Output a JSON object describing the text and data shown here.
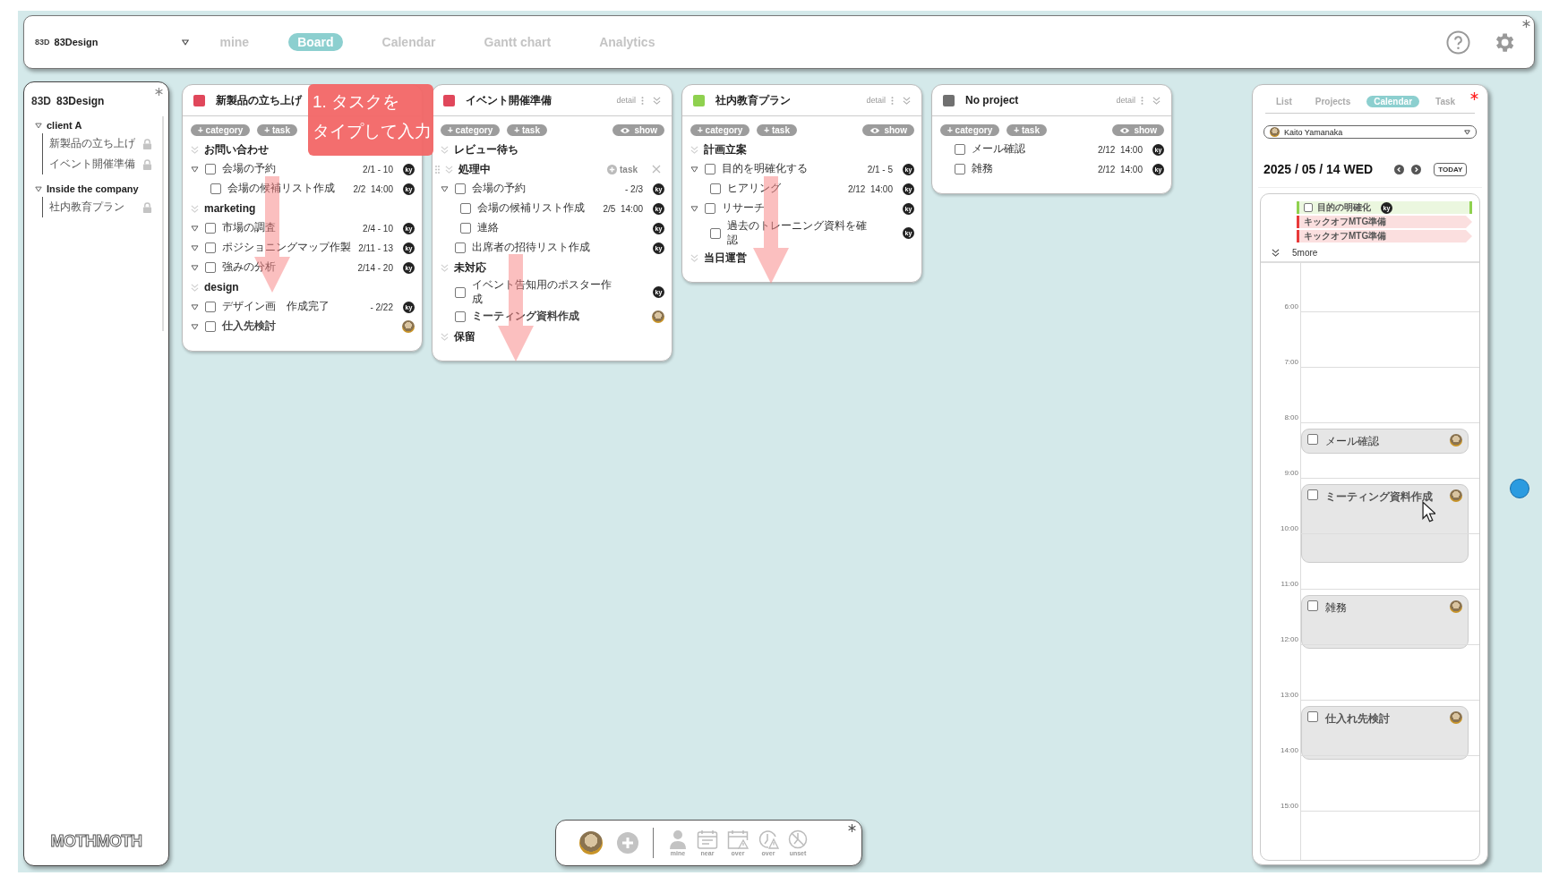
{
  "top_bar": {
    "logo": "83D",
    "workspace": "83Design",
    "tabs": [
      {
        "label": "mine",
        "selected": false
      },
      {
        "label": "Board",
        "selected": true
      },
      {
        "label": "Calendar",
        "selected": false
      },
      {
        "label": "Gantt chart",
        "selected": false
      },
      {
        "label": "Analytics",
        "selected": false
      }
    ]
  },
  "sidebar": {
    "logo": "83D",
    "workspace": "83Design",
    "groups": [
      {
        "name": "client A",
        "expanded": true,
        "projects": [
          {
            "name": "新製品の立ち上げ",
            "locked": true
          },
          {
            "name": "イベント開催準備",
            "locked": true
          }
        ]
      },
      {
        "name": "Inside the company",
        "expanded": true,
        "projects": [
          {
            "name": "社内教育プラン",
            "locked": true
          }
        ]
      }
    ],
    "footer_logo": "MOTHMOTH"
  },
  "board": {
    "columns": [
      {
        "title": "新製品の立ち上げ",
        "color": "#e0475b",
        "chips": [
          "+ category",
          "+ task"
        ],
        "categories": [
          {
            "name": "お問い合わせ",
            "tasks": [
              {
                "name": "会場の予約",
                "date": "2/1 - 10",
                "checked": false,
                "collapsible": true,
                "assignee": {
                  "kind": "initials",
                  "text": "ky"
                },
                "children": [
                  {
                    "name": "会場の候補リスト作成",
                    "date": "2/2  14:00",
                    "checked": false,
                    "assignee": {
                      "kind": "initials",
                      "text": "ky"
                    }
                  }
                ]
              }
            ]
          },
          {
            "name": "marketing",
            "tasks": [
              {
                "name": "市場の調査",
                "date": "2/4 - 10",
                "checked": false,
                "collapsible": true,
                "assignee": {
                  "kind": "initials",
                  "text": "ky"
                }
              },
              {
                "name": "ポジショニングマップ作製",
                "date": "2/11 - 13",
                "checked": false,
                "collapsible": true,
                "assignee": {
                  "kind": "initials",
                  "text": "ky"
                }
              },
              {
                "name": "強みの分析",
                "date": "2/14 - 20",
                "checked": false,
                "collapsible": true,
                "assignee": {
                  "kind": "initials",
                  "text": "ky"
                }
              }
            ]
          },
          {
            "name": "design",
            "tasks": [
              {
                "name": "デザイン画　作成完了",
                "date": "- 2/22",
                "checked": false,
                "collapsible": true,
                "assignee": {
                  "kind": "initials",
                  "text": "ky"
                }
              },
              {
                "name": "仕入先検討",
                "checked": false,
                "collapsible": true,
                "emphasis": true,
                "assignee": {
                  "kind": "photo"
                }
              }
            ]
          }
        ]
      },
      {
        "title": "イベント開催準備",
        "color": "#e0475b",
        "detail": "detail",
        "chips": [
          "+ category",
          "+ task"
        ],
        "show": "show",
        "categories": [
          {
            "name": "レビュー待ち"
          },
          {
            "name": "処理中",
            "draggable": true,
            "add_task": "task",
            "tasks": [
              {
                "name": "会場の予約",
                "date": "- 2/3",
                "checked": false,
                "collapsible": true,
                "assignee": {
                  "kind": "initials",
                  "text": "ky"
                },
                "children": [
                  {
                    "name": "会場の候補リスト作成",
                    "date": "2/5  14:00",
                    "checked": false,
                    "assignee": {
                      "kind": "initials",
                      "text": "ky"
                    }
                  },
                  {
                    "name": "連絡",
                    "checked": false,
                    "assignee": {
                      "kind": "initials",
                      "text": "ky"
                    }
                  }
                ]
              },
              {
                "name": "出席者の招待リスト作成",
                "checked": false,
                "assignee": {
                  "kind": "initials",
                  "text": "ky"
                }
              }
            ]
          },
          {
            "name": "未対応",
            "tasks": [
              {
                "name": "イベント告知用のポスター作成",
                "checked": false,
                "assignee": {
                  "kind": "initials",
                  "text": "ky"
                }
              },
              {
                "name": "ミーティング資料作成",
                "checked": false,
                "emphasis": true,
                "assignee": {
                  "kind": "photo"
                }
              }
            ]
          },
          {
            "name": "保留"
          }
        ]
      },
      {
        "title": "社内教育プラン",
        "color": "#8fd14f",
        "detail": "detail",
        "chips": [
          "+ category",
          "+ task"
        ],
        "show": "show",
        "categories": [
          {
            "name": "計画立案",
            "tasks": [
              {
                "name": "目的を明確化する",
                "date": "2/1 - 5",
                "checked": false,
                "collapsible": true,
                "assignee": {
                  "kind": "initials",
                  "text": "ky"
                },
                "children": [
                  {
                    "name": "ヒアリング",
                    "date": "2/12  14:00",
                    "checked": false,
                    "assignee": {
                      "kind": "initials",
                      "text": "ky"
                    }
                  }
                ]
              },
              {
                "name": "リサーチ",
                "checked": false,
                "collapsible": true,
                "assignee": {
                  "kind": "initials",
                  "text": "ky"
                },
                "children": [
                  {
                    "name": "過去のトレーニング資料を確認",
                    "checked": false,
                    "assignee": {
                      "kind": "initials",
                      "text": "ky"
                    }
                  }
                ]
              }
            ]
          },
          {
            "name": "当日運営"
          }
        ]
      },
      {
        "title": "No project",
        "color": "#707070",
        "detail": "detail",
        "chips": [
          "+ category",
          "+ task"
        ],
        "show": "show",
        "categories": [
          {
            "tasks": [
              {
                "name": "メール確認",
                "date": "2/12  14:00",
                "checked": false,
                "assignee": {
                  "kind": "initials",
                  "text": "ky"
                }
              },
              {
                "name": "雑務",
                "date": "2/12  14:00",
                "checked": false,
                "assignee": {
                  "kind": "initials",
                  "text": "ky"
                }
              }
            ]
          }
        ]
      }
    ]
  },
  "callout": {
    "lines": [
      "1. タスクを",
      "タイプして入力"
    ]
  },
  "right_panel": {
    "tabs": [
      {
        "label": "List",
        "selected": false
      },
      {
        "label": "Projects",
        "selected": false
      },
      {
        "label": "Calendar",
        "selected": true
      },
      {
        "label": "Task",
        "selected": false
      }
    ],
    "user": "Kaito Yamanaka",
    "date": "2025 / 05 / 14 WED",
    "today": "TODAY",
    "all_day": [
      {
        "kind": "task",
        "title": "目的の明確化",
        "color": "#8fd14f",
        "checked": false,
        "assignee": "ky"
      },
      {
        "kind": "event",
        "title": "キックオフMTG準備",
        "color": "#e83a3a"
      },
      {
        "kind": "event",
        "title": "キックオフMTG準備",
        "color": "#e83a3a"
      }
    ],
    "more": "5more",
    "hours": [
      {
        "label": "6:00"
      },
      {
        "label": "7:00"
      },
      {
        "label": "8:00",
        "events": [
          {
            "title": "メール確認",
            "kind": "short",
            "checked": false
          }
        ]
      },
      {
        "label": "9:00",
        "events": [
          {
            "title": "ミーティング資料作成",
            "kind": "long",
            "checked": false,
            "emphasis": true
          }
        ]
      },
      {
        "label": "10:00"
      },
      {
        "label": "11:00",
        "events": [
          {
            "title": "雑務",
            "kind": "medium",
            "checked": false
          }
        ]
      },
      {
        "label": "12:00"
      },
      {
        "label": "13:00",
        "events": [
          {
            "title": "仕入れ先検討",
            "kind": "medium",
            "checked": false,
            "emphasis": true
          }
        ]
      },
      {
        "label": "14:00"
      },
      {
        "label": "15:00"
      }
    ]
  },
  "toolbar": {
    "filters": [
      {
        "kind": "person",
        "label": "mine"
      },
      {
        "kind": "calendar",
        "label": "near"
      },
      {
        "kind": "calendar_warning",
        "label": "over"
      },
      {
        "kind": "clock_warning",
        "label": "over"
      },
      {
        "kind": "clock_cross",
        "label": "unset"
      }
    ]
  }
}
